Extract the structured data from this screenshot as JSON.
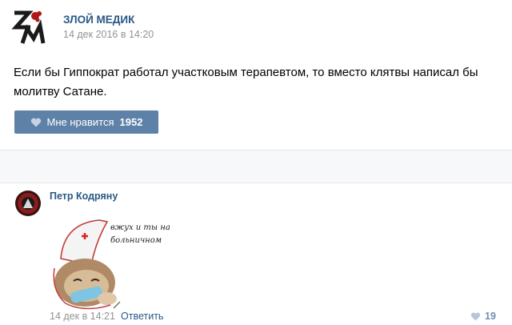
{
  "post": {
    "group_name": "ЗЛОЙ МЕДИК",
    "date": "14 дек 2016 в 14:20",
    "text": "Если бы Гиппократ работал участковым терапевтом, то вместо клятвы написал бы молитву Сатане.",
    "like_label": "Мне нравится",
    "like_count": "1952"
  },
  "comment": {
    "author": "Петр Кодряну",
    "sticker_text_line1": "вжух и ты на",
    "sticker_text_line2": "больничном",
    "date": "14 дек в 14:21",
    "reply_label": "Ответить",
    "like_count": "19"
  },
  "icons": {
    "like": "heart-icon"
  },
  "colors": {
    "link": "#2a5885",
    "like_button": "#5e81a8",
    "muted": "#939393"
  }
}
